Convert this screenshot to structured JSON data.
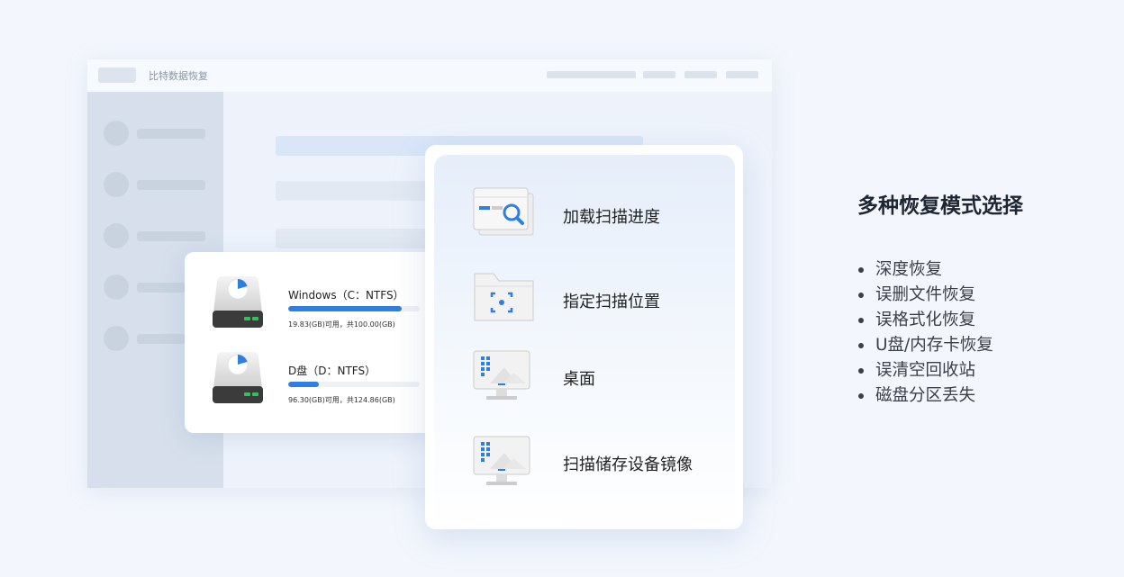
{
  "window": {
    "title": "比特数据恢复"
  },
  "drives": [
    {
      "name": "Windows（C：NTFS）",
      "info": "19.83(GB)可用，共100.00(GB)",
      "used_fraction": 0.86
    },
    {
      "name": "D盘（D：NTFS）",
      "info": "96.30(GB)可用，共124.86(GB)",
      "used_fraction": 0.23
    }
  ],
  "options": [
    {
      "label": "加载扫描进度",
      "icon": "window-search-icon"
    },
    {
      "label": "指定扫描位置",
      "icon": "folder-target-icon"
    },
    {
      "label": "桌面",
      "icon": "desktop-monitor-icon"
    },
    {
      "label": "扫描储存设备镜像",
      "icon": "monitor-image-icon"
    }
  ],
  "panel": {
    "title": "多种恢复模式选择",
    "features": [
      "深度恢复",
      "误删文件恢复",
      "误格式化恢复",
      "U盘/内存卡恢复",
      "误清空回收站",
      "磁盘分区丢失"
    ]
  },
  "colors": {
    "accent": "#2f7ee2",
    "background": "#f3f7fd",
    "sidebar": "#d6dfeb"
  }
}
